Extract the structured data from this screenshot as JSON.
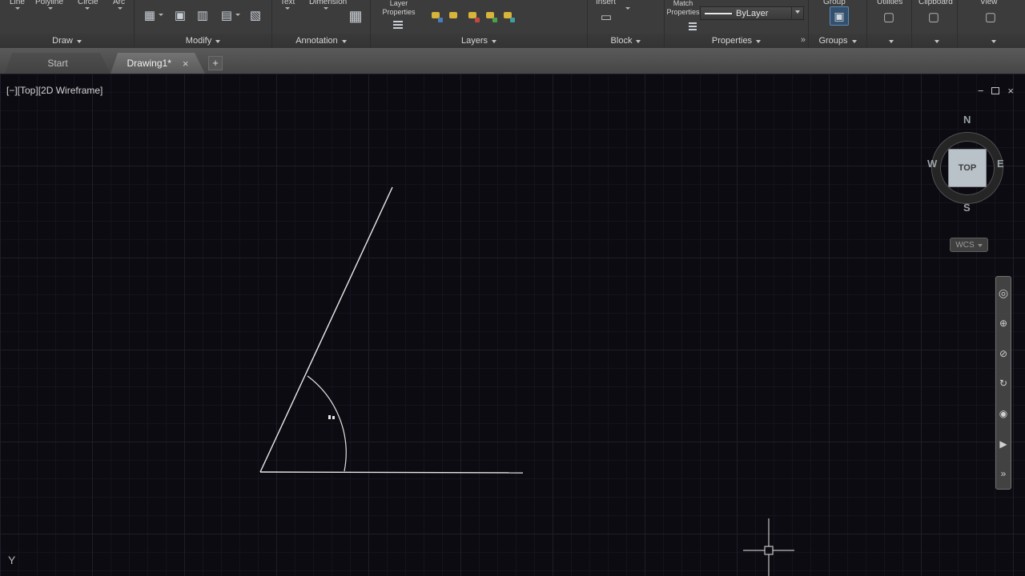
{
  "colors": {
    "ribbon_bg": "#3c3c3c",
    "tabbar_bg": "#4d4d4d",
    "canvas_bg": "#0b0b11",
    "grid_minor": "#14141d",
    "grid_major": "#1e1e2b",
    "geometry_line": "#eaeaea",
    "viewcube_face": "#b9c2c9",
    "layer_icon_yellow": "#d9b43a",
    "group_highlight_blue": "#33506e"
  },
  "ribbon": {
    "draw": {
      "labels": [
        "Line",
        "Polyline",
        "Circle",
        "Arc"
      ],
      "footer": "Draw"
    },
    "modify": {
      "footer": "Modify"
    },
    "annotation": {
      "labels": [
        "Text",
        "Dimension"
      ],
      "footer": "Annotation"
    },
    "layers": {
      "button_line1": "Layer",
      "button_line2": "Properties",
      "footer": "Layers"
    },
    "block": {
      "label": "Insert",
      "footer": "Block"
    },
    "properties": {
      "button_line1": "Match",
      "button_line2": "Properties",
      "combo_value": "ByLayer",
      "footer": "Properties",
      "launcher_glyph": "»"
    },
    "groups": {
      "label": "Group",
      "footer": "Groups"
    },
    "utilities": {
      "label": "Utilities"
    },
    "clipboard": {
      "label": "Clipboard"
    },
    "view": {
      "label": "View"
    }
  },
  "tabs": {
    "start": "Start",
    "drawing": "Drawing1*",
    "close_glyph": "×",
    "new_tab_glyph": "+"
  },
  "viewport": {
    "controls_label": "[−][Top][2D Wireframe]",
    "window_buttons": {
      "minimize": "−",
      "close": "×"
    },
    "viewcube": {
      "north": "N",
      "east": "E",
      "south": "S",
      "west": "W",
      "face": "TOP"
    },
    "wcs_label": "WCS",
    "ucs_axis_label": "Y"
  },
  "navbar": {
    "items": [
      {
        "name": "navigation-wheel",
        "glyph": "◎"
      },
      {
        "name": "pan",
        "glyph": "⊕"
      },
      {
        "name": "zoom",
        "glyph": "⊘"
      },
      {
        "name": "orbit",
        "glyph": "↻"
      },
      {
        "name": "look",
        "glyph": "◉"
      },
      {
        "name": "show-motion",
        "glyph": "▶"
      },
      {
        "name": "more-tools",
        "glyph": "»"
      }
    ]
  }
}
